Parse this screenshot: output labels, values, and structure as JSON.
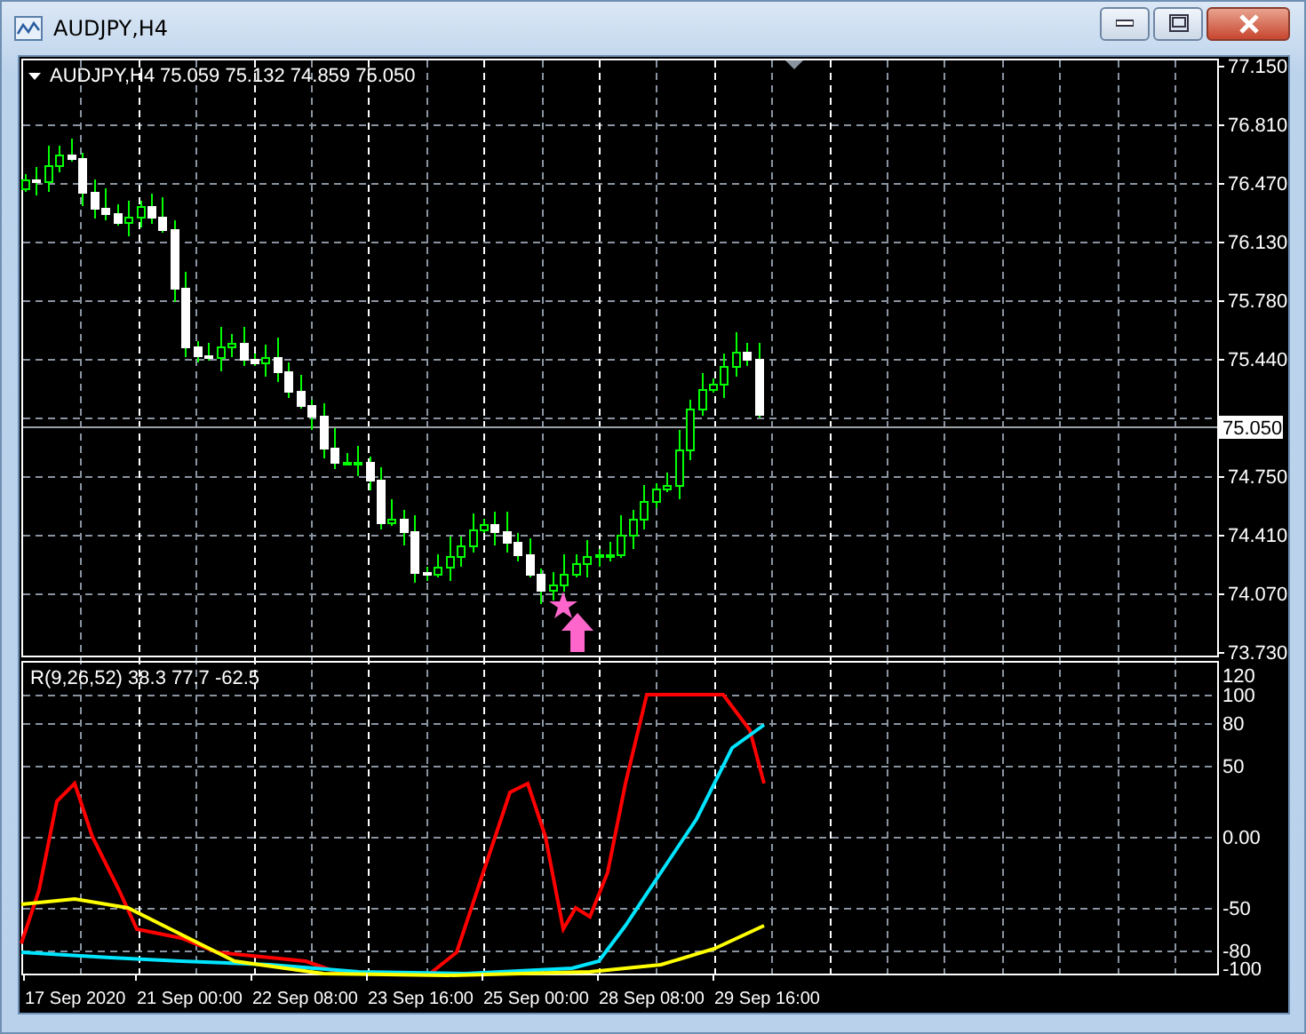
{
  "window": {
    "title": "AUDJPY,H4"
  },
  "chart": {
    "symbol": "AUDJPY,H4",
    "ohlc": "75.059 75.132 74.859 75.050",
    "current_price": "75.050",
    "price_labels": [
      "77.150",
      "76.810",
      "76.470",
      "76.130",
      "75.780",
      "75.440",
      "74.750",
      "74.410",
      "74.070",
      "73.730"
    ]
  },
  "indicator": {
    "readout": "R(9,26,52) 38.3 77.7 -62.5",
    "scale_labels": [
      "120",
      "100",
      "80",
      "50",
      "0.00",
      "-50",
      "-80",
      "-100"
    ]
  },
  "time_labels": [
    "17 Sep 2020",
    "21 Sep 00:00",
    "22 Sep 08:00",
    "23 Sep 16:00",
    "25 Sep 00:00",
    "28 Sep 08:00",
    "29 Sep 16:00"
  ]
}
